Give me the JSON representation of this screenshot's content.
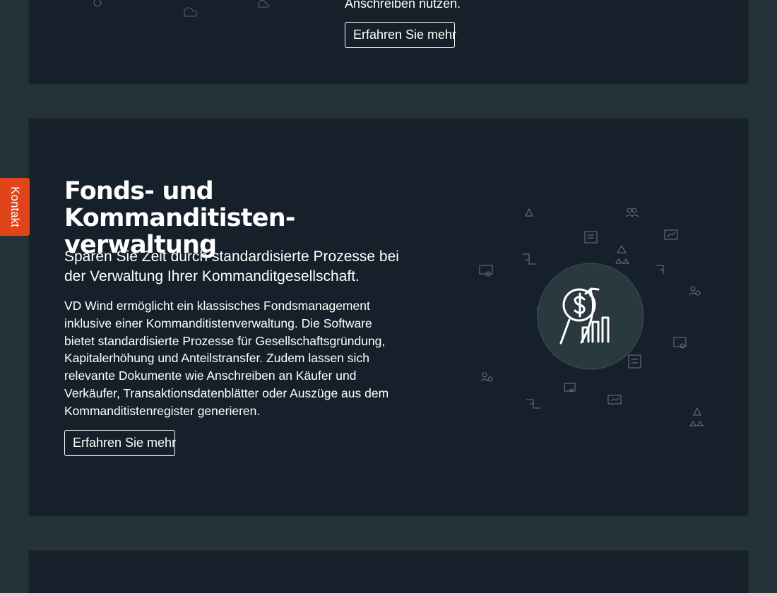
{
  "top_card": {
    "text": "Anschreiben nutzen.",
    "button_label": "Erfahren Sie mehr"
  },
  "main_card": {
    "title_line1": "Fonds- und Kommanditisten-",
    "title_line2": "verwaltung",
    "lead": "Sparen Sie Zeit durch standardisierte Prozesse bei der Verwaltung Ihrer Kommanditgesellschaft.",
    "body": "VD Wind ermöglicht ein klassisches Fondsmanagement inklusive einer Kommanditistenverwaltung. Die Software bietet standardisierte Prozesse für Gesellschaftsgründung, Kapitalerhöhung und Anteilstransfer. Zudem lassen sich relevante Dokumente wie Anschreiben an Käufer und Verkäufer, Transaktionsdatenblätter oder Auszüge aus dem Kommanditistenregister generieren.",
    "button_label": "Erfahren Sie mehr",
    "illustration_icon": "money-growth-icon"
  },
  "contact_tab": {
    "label": "Kontakt"
  },
  "colors": {
    "page_bg": "#253239",
    "card_bg": "#15202a",
    "accent": "#e0441b",
    "text": "#ffffff"
  }
}
